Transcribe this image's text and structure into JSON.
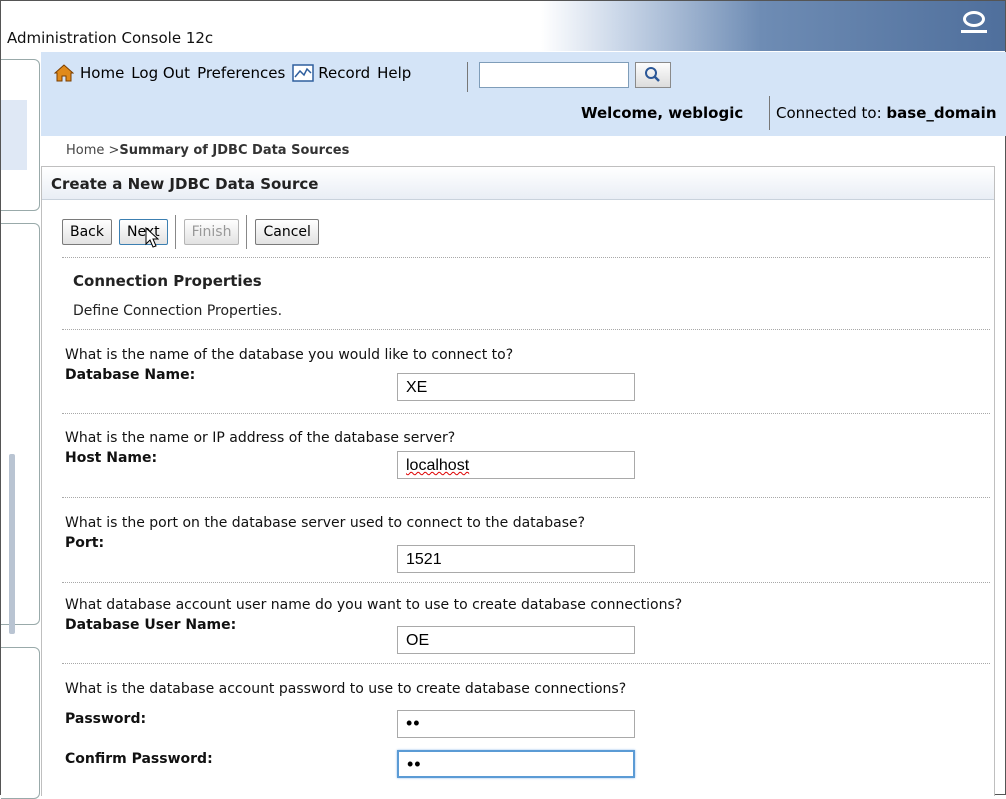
{
  "window": {
    "title": "Administration Console 12c"
  },
  "toolbar": {
    "home": "Home",
    "logout": "Log Out",
    "preferences": "Preferences",
    "record": "Record",
    "help": "Help",
    "search_value": "",
    "welcome": "Welcome, weblogic",
    "connected_label": "Connected to: ",
    "connected_domain": "base_domain"
  },
  "breadcrumb": {
    "home": "Home >",
    "current": "Summary of JDBC Data Sources"
  },
  "panel": {
    "title": "Create a New JDBC Data Source"
  },
  "buttons": {
    "back": "Back",
    "next": "Next",
    "finish": "Finish",
    "cancel": "Cancel"
  },
  "section": {
    "title": "Connection Properties",
    "description": "Define Connection Properties."
  },
  "fields": [
    {
      "question": "What is the name of the database you would like to connect to?",
      "label": "Database Name:",
      "value": "XE"
    },
    {
      "question": "What is the name or IP address of the database server?",
      "label": "Host Name:",
      "value": "localhost"
    },
    {
      "question": "What is the port on the database server used to connect to the database?",
      "label": "Port:",
      "value": "1521"
    },
    {
      "question": "What database account user name do you want to use to create database connections?",
      "label": "Database User Name:",
      "value": "OE"
    },
    {
      "question": "What is the database account password to use to create database connections?",
      "label": "Password:",
      "value": "••"
    },
    {
      "label": "Confirm Password:",
      "value": "••"
    }
  ],
  "icons": [
    "home-icon",
    "record-icon",
    "search-icon",
    "oracle-logo-icon",
    "cursor-pointer-icon"
  ]
}
